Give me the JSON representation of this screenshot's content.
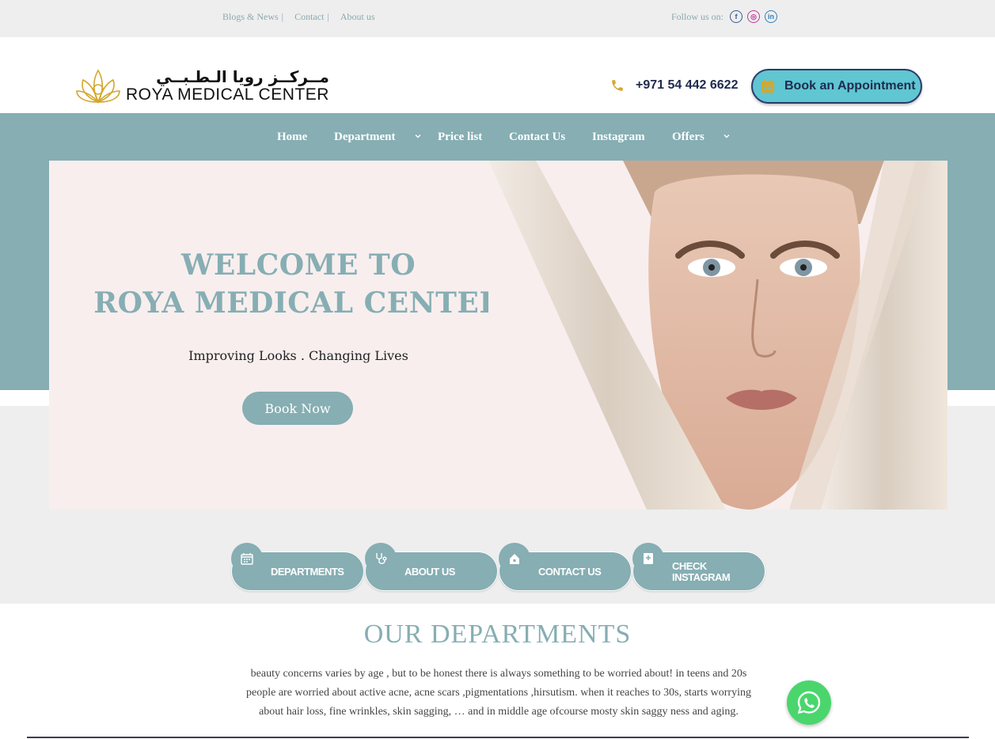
{
  "topbar": {
    "links": [
      "Blogs & News",
      "Contact",
      "About us"
    ],
    "separator": "|",
    "follow_label": "Follow us on:",
    "social": [
      {
        "name": "facebook-icon",
        "glyph": "f",
        "color": "#3b5998"
      },
      {
        "name": "instagram-icon",
        "glyph": "◎",
        "color": "#c2379a"
      },
      {
        "name": "linkedin-icon",
        "glyph": "in",
        "color": "#2f7fbf"
      }
    ]
  },
  "header": {
    "logo_arabic": "مــركــز رويا الـطـبــي",
    "logo_english": "ROYA MEDICAL CENTER",
    "phone": "+971 54 442 6622",
    "book_label": "Book an Appointment"
  },
  "nav": {
    "items": [
      "Home",
      "Department",
      "Price list",
      "Contact Us",
      "Instagram",
      "Offers"
    ]
  },
  "hero": {
    "title_line1": "WELCOME TO",
    "title_line2": "ROYA MEDICAL CENTER",
    "subtitle": "Improving Looks . Changing Lives",
    "button": "Book Now"
  },
  "quick_buttons": [
    {
      "label": "DEPARTMENTS",
      "icon": "calendar-icon"
    },
    {
      "label": "ABOUT US",
      "icon": "stethoscope-icon"
    },
    {
      "label": "CONTACT US",
      "icon": "home-icon"
    },
    {
      "label_line1": "CHECK",
      "label_line2": "INSTAGRAM",
      "icon": "book-icon"
    }
  ],
  "departments": {
    "title": "OUR DEPARTMENTS",
    "text": "beauty concerns varies by age , but to be honest there is always something to be worried about! in teens and 20s people are worried about active acne, acne scars ,pigmentations ,hirsutism. when it reaches to 30s, starts worrying about hair loss, fine wrinkles, skin sagging, … and in middle age ofcourse mosty skin saggy ness and aging."
  },
  "colors": {
    "accent": "#86aeb3",
    "brand_navy": "#1f2a4d",
    "book_button": "#5fc6d2",
    "gold": "#d4a72c",
    "whatsapp": "#4ad66c"
  }
}
